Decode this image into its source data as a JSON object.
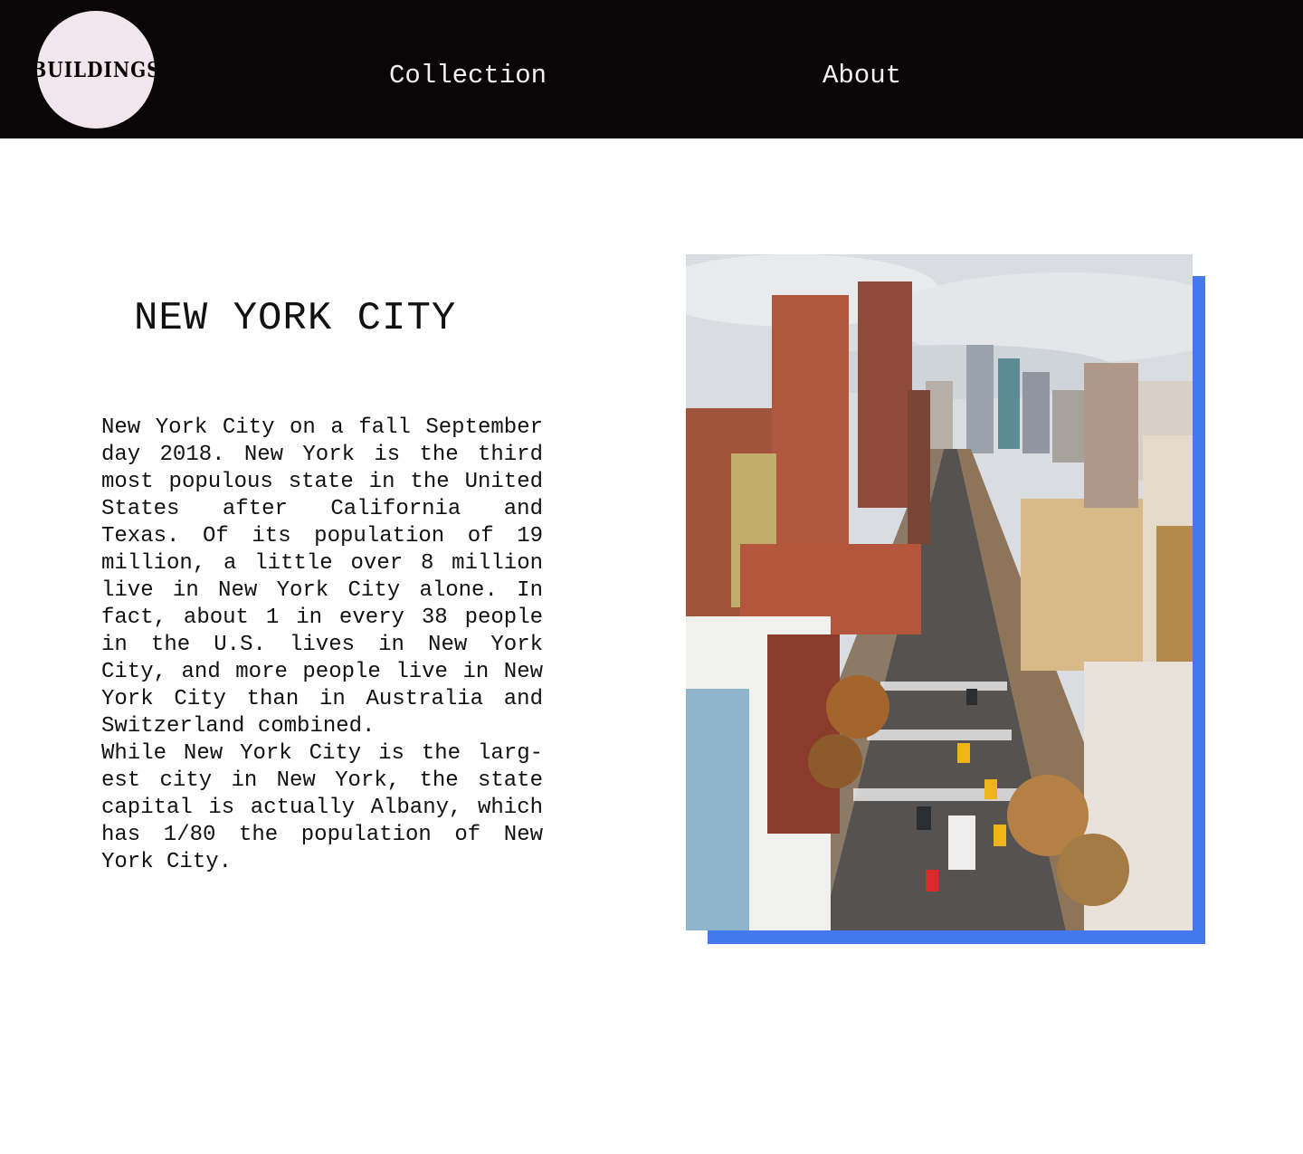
{
  "brand": {
    "logo_text": "BUILDINGS"
  },
  "nav": {
    "items": [
      {
        "label": "Collection"
      },
      {
        "label": "About"
      }
    ]
  },
  "main": {
    "title": "NEW YORK CITY",
    "paragraphs": [
      "New York City on a fall September day 2018. New York is the third most populous state in the United States after California and Texas. Of its population of 19 million, a little over 8 million live in New York City alone. In fact, about 1 in every 38 people in the U.S. lives in New York City, and more people live in New York City than in Australia and Switzerland combined.",
      "While New York City is the larg-est city in New York, the state capital is actually Albany, which has 1/80 the population of New York City."
    ]
  },
  "colors": {
    "navbar_bg": "#0a0506",
    "logo_bg": "#f1e6ec",
    "accent_shadow": "#4479ee"
  }
}
